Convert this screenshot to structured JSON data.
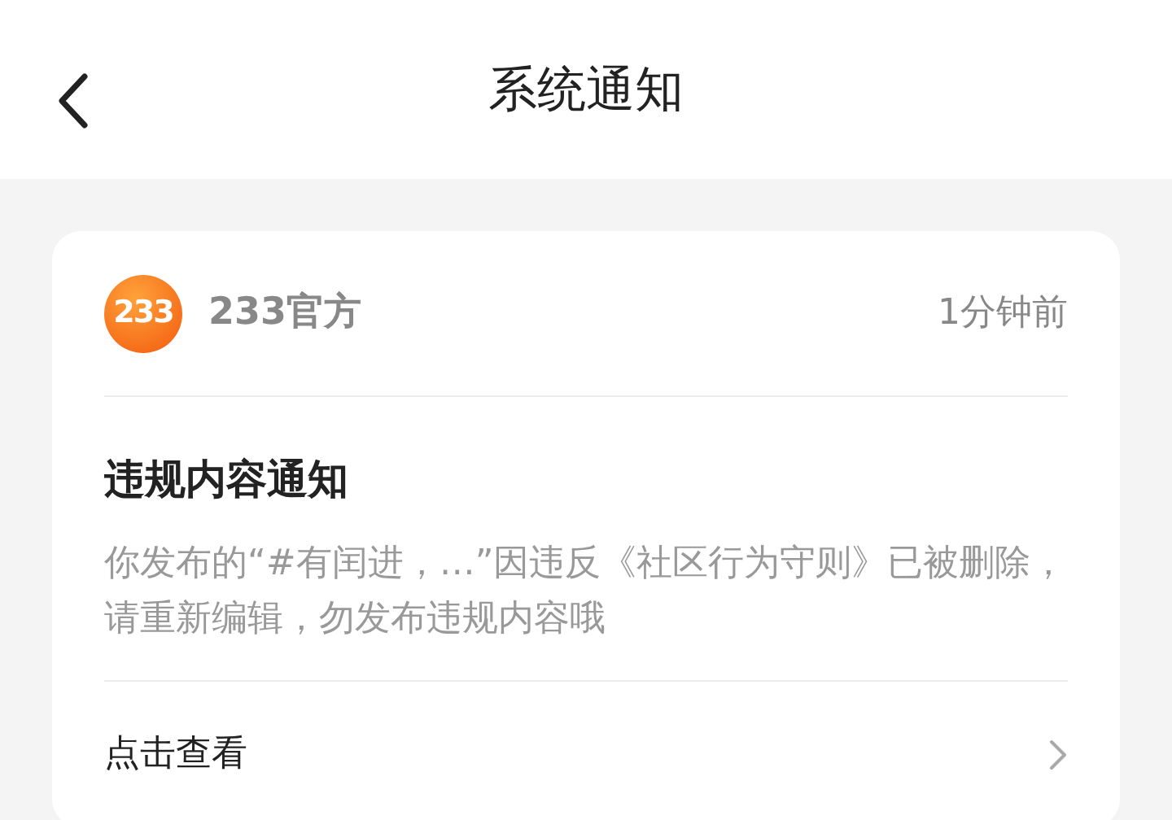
{
  "header": {
    "title": "系统通知"
  },
  "notification": {
    "logo_text": "233",
    "sender": "233官方",
    "time": "1分钟前",
    "title": "违规内容通知",
    "body": "你发布的“#有闰进，…”因违反《社区行为守则》已被删除，请重新编辑，勿发布违规内容哦",
    "action": "点击查看"
  }
}
